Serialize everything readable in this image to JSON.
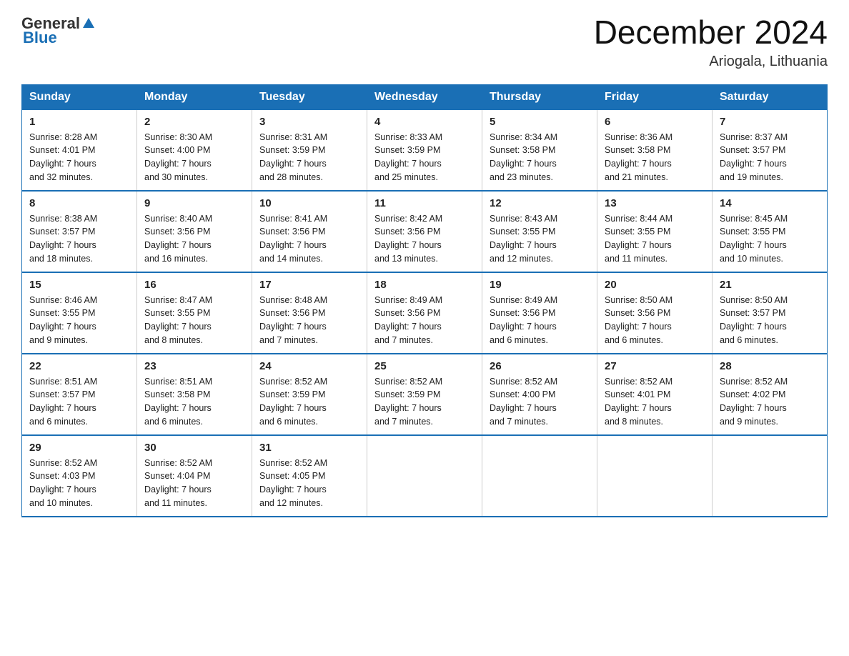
{
  "header": {
    "logo_general": "General",
    "logo_blue": "Blue",
    "title": "December 2024",
    "location": "Ariogala, Lithuania"
  },
  "weekdays": [
    "Sunday",
    "Monday",
    "Tuesday",
    "Wednesday",
    "Thursday",
    "Friday",
    "Saturday"
  ],
  "weeks": [
    [
      {
        "day": "1",
        "sunrise": "8:28 AM",
        "sunset": "4:01 PM",
        "daylight": "7 hours and 32 minutes."
      },
      {
        "day": "2",
        "sunrise": "8:30 AM",
        "sunset": "4:00 PM",
        "daylight": "7 hours and 30 minutes."
      },
      {
        "day": "3",
        "sunrise": "8:31 AM",
        "sunset": "3:59 PM",
        "daylight": "7 hours and 28 minutes."
      },
      {
        "day": "4",
        "sunrise": "8:33 AM",
        "sunset": "3:59 PM",
        "daylight": "7 hours and 25 minutes."
      },
      {
        "day": "5",
        "sunrise": "8:34 AM",
        "sunset": "3:58 PM",
        "daylight": "7 hours and 23 minutes."
      },
      {
        "day": "6",
        "sunrise": "8:36 AM",
        "sunset": "3:58 PM",
        "daylight": "7 hours and 21 minutes."
      },
      {
        "day": "7",
        "sunrise": "8:37 AM",
        "sunset": "3:57 PM",
        "daylight": "7 hours and 19 minutes."
      }
    ],
    [
      {
        "day": "8",
        "sunrise": "8:38 AM",
        "sunset": "3:57 PM",
        "daylight": "7 hours and 18 minutes."
      },
      {
        "day": "9",
        "sunrise": "8:40 AM",
        "sunset": "3:56 PM",
        "daylight": "7 hours and 16 minutes."
      },
      {
        "day": "10",
        "sunrise": "8:41 AM",
        "sunset": "3:56 PM",
        "daylight": "7 hours and 14 minutes."
      },
      {
        "day": "11",
        "sunrise": "8:42 AM",
        "sunset": "3:56 PM",
        "daylight": "7 hours and 13 minutes."
      },
      {
        "day": "12",
        "sunrise": "8:43 AM",
        "sunset": "3:55 PM",
        "daylight": "7 hours and 12 minutes."
      },
      {
        "day": "13",
        "sunrise": "8:44 AM",
        "sunset": "3:55 PM",
        "daylight": "7 hours and 11 minutes."
      },
      {
        "day": "14",
        "sunrise": "8:45 AM",
        "sunset": "3:55 PM",
        "daylight": "7 hours and 10 minutes."
      }
    ],
    [
      {
        "day": "15",
        "sunrise": "8:46 AM",
        "sunset": "3:55 PM",
        "daylight": "7 hours and 9 minutes."
      },
      {
        "day": "16",
        "sunrise": "8:47 AM",
        "sunset": "3:55 PM",
        "daylight": "7 hours and 8 minutes."
      },
      {
        "day": "17",
        "sunrise": "8:48 AM",
        "sunset": "3:56 PM",
        "daylight": "7 hours and 7 minutes."
      },
      {
        "day": "18",
        "sunrise": "8:49 AM",
        "sunset": "3:56 PM",
        "daylight": "7 hours and 7 minutes."
      },
      {
        "day": "19",
        "sunrise": "8:49 AM",
        "sunset": "3:56 PM",
        "daylight": "7 hours and 6 minutes."
      },
      {
        "day": "20",
        "sunrise": "8:50 AM",
        "sunset": "3:56 PM",
        "daylight": "7 hours and 6 minutes."
      },
      {
        "day": "21",
        "sunrise": "8:50 AM",
        "sunset": "3:57 PM",
        "daylight": "7 hours and 6 minutes."
      }
    ],
    [
      {
        "day": "22",
        "sunrise": "8:51 AM",
        "sunset": "3:57 PM",
        "daylight": "7 hours and 6 minutes."
      },
      {
        "day": "23",
        "sunrise": "8:51 AM",
        "sunset": "3:58 PM",
        "daylight": "7 hours and 6 minutes."
      },
      {
        "day": "24",
        "sunrise": "8:52 AM",
        "sunset": "3:59 PM",
        "daylight": "7 hours and 6 minutes."
      },
      {
        "day": "25",
        "sunrise": "8:52 AM",
        "sunset": "3:59 PM",
        "daylight": "7 hours and 7 minutes."
      },
      {
        "day": "26",
        "sunrise": "8:52 AM",
        "sunset": "4:00 PM",
        "daylight": "7 hours and 7 minutes."
      },
      {
        "day": "27",
        "sunrise": "8:52 AM",
        "sunset": "4:01 PM",
        "daylight": "7 hours and 8 minutes."
      },
      {
        "day": "28",
        "sunrise": "8:52 AM",
        "sunset": "4:02 PM",
        "daylight": "7 hours and 9 minutes."
      }
    ],
    [
      {
        "day": "29",
        "sunrise": "8:52 AM",
        "sunset": "4:03 PM",
        "daylight": "7 hours and 10 minutes."
      },
      {
        "day": "30",
        "sunrise": "8:52 AM",
        "sunset": "4:04 PM",
        "daylight": "7 hours and 11 minutes."
      },
      {
        "day": "31",
        "sunrise": "8:52 AM",
        "sunset": "4:05 PM",
        "daylight": "7 hours and 12 minutes."
      },
      null,
      null,
      null,
      null
    ]
  ],
  "labels": {
    "sunrise": "Sunrise:",
    "sunset": "Sunset:",
    "daylight": "Daylight:"
  }
}
